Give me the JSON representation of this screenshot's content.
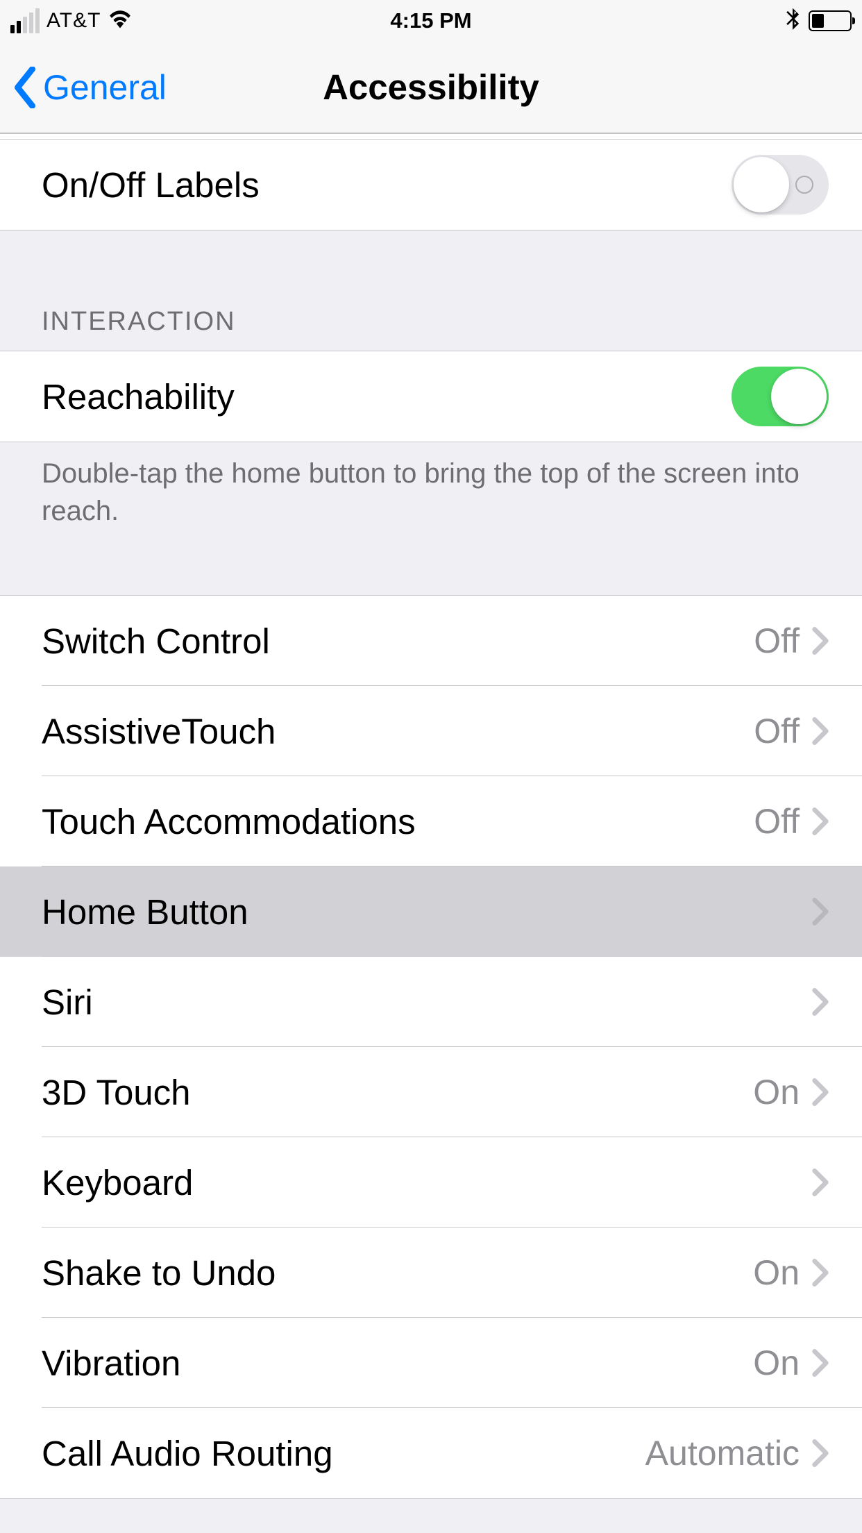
{
  "statusBar": {
    "carrier": "AT&T",
    "time": "4:15 PM"
  },
  "nav": {
    "back": "General",
    "title": "Accessibility"
  },
  "sections": {
    "top": {
      "onOffLabels": {
        "label": "On/Off Labels",
        "on": false
      }
    },
    "interaction": {
      "header": "INTERACTION",
      "reachability": {
        "label": "Reachability",
        "on": true
      },
      "footer": "Double-tap the home button to bring the top of the screen into reach."
    },
    "controls": {
      "items": [
        {
          "label": "Switch Control",
          "value": "Off"
        },
        {
          "label": "AssistiveTouch",
          "value": "Off"
        },
        {
          "label": "Touch Accommodations",
          "value": "Off"
        },
        {
          "label": "Home Button",
          "value": ""
        },
        {
          "label": "Siri",
          "value": ""
        },
        {
          "label": "3D Touch",
          "value": "On"
        },
        {
          "label": "Keyboard",
          "value": ""
        },
        {
          "label": "Shake to Undo",
          "value": "On"
        },
        {
          "label": "Vibration",
          "value": "On"
        },
        {
          "label": "Call Audio Routing",
          "value": "Automatic"
        }
      ]
    }
  }
}
